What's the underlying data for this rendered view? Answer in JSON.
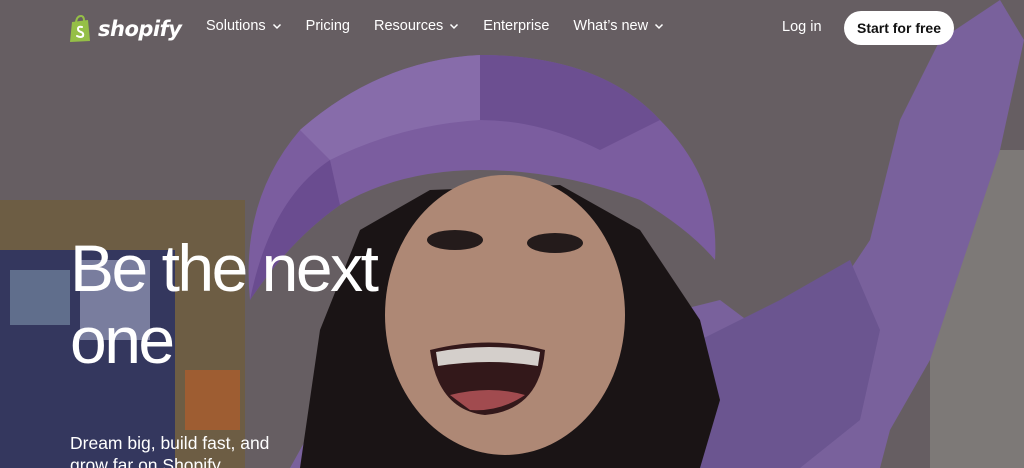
{
  "brand": {
    "name": "shopify",
    "logo_icon": "shopping-bag-icon",
    "logo_color": "#95bf47"
  },
  "nav": {
    "items": [
      {
        "label": "Solutions",
        "has_dropdown": true
      },
      {
        "label": "Pricing",
        "has_dropdown": false
      },
      {
        "label": "Resources",
        "has_dropdown": true
      },
      {
        "label": "Enterprise",
        "has_dropdown": false
      },
      {
        "label": "What’s new",
        "has_dropdown": true
      }
    ],
    "login_label": "Log in",
    "cta_label": "Start for free"
  },
  "hero": {
    "headline": "Be the next one",
    "subheadline": "Dream big, build fast, and grow far on Shopify"
  }
}
